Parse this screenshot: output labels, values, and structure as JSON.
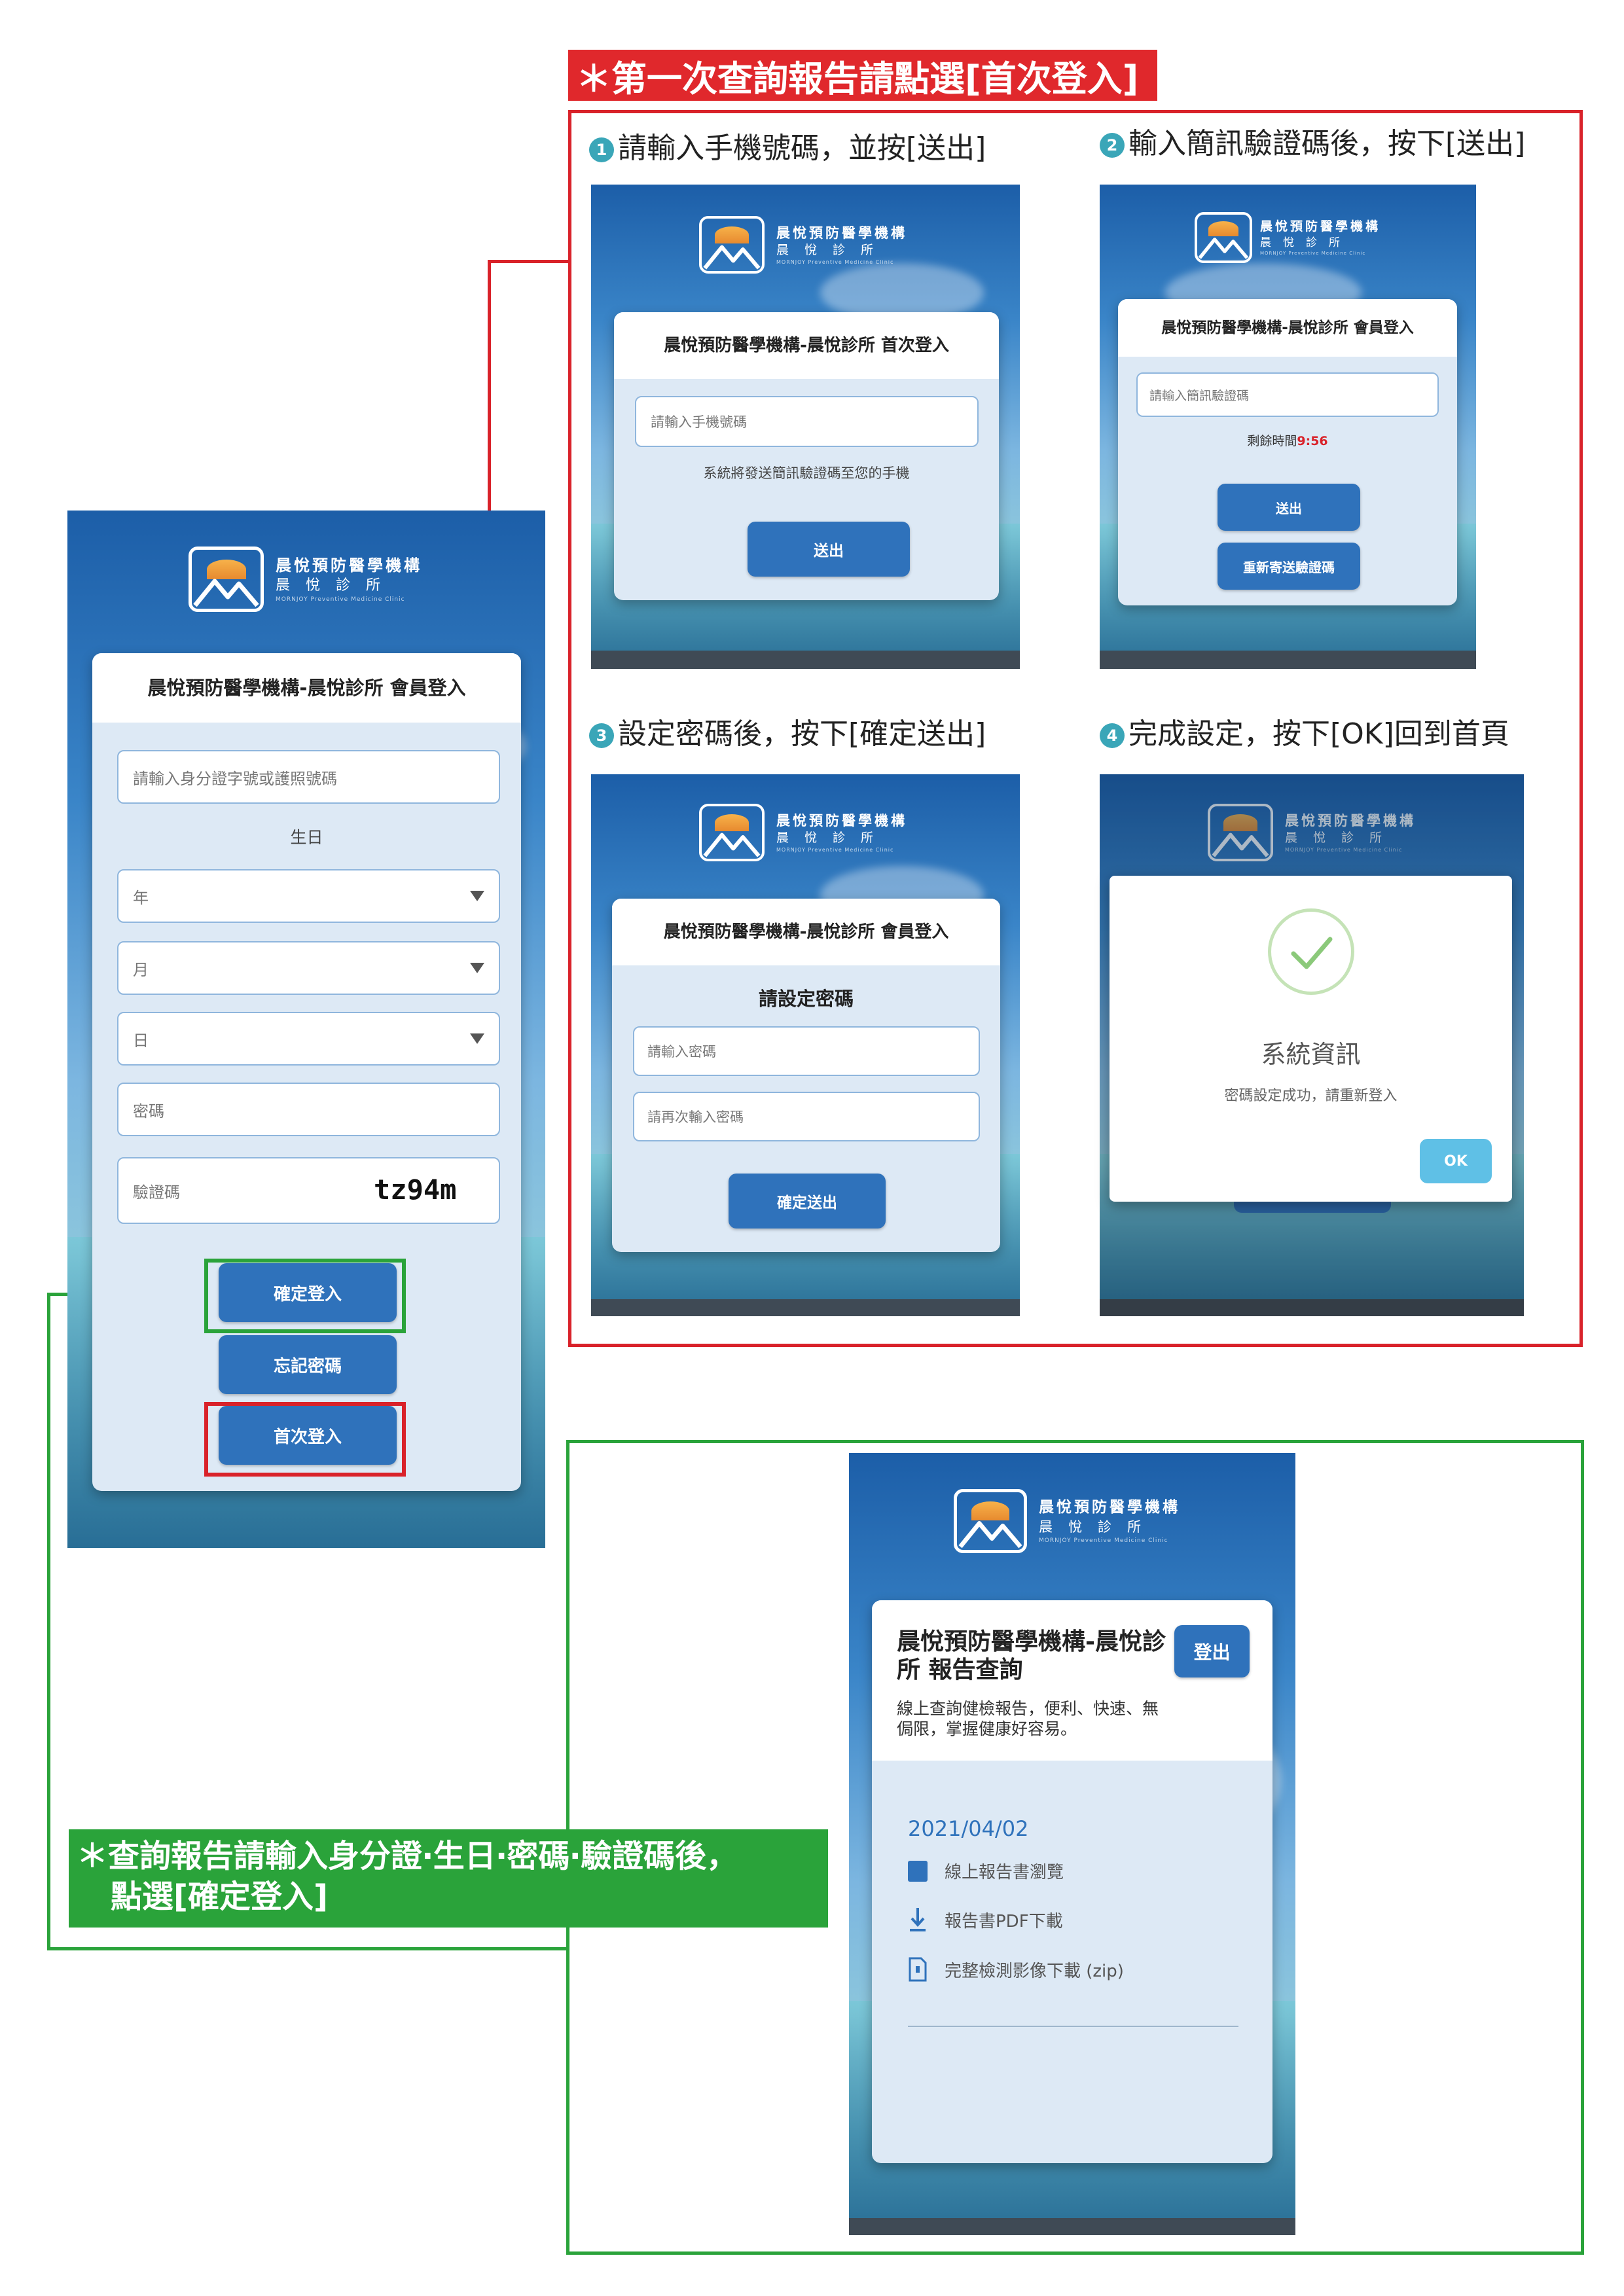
{
  "colors": {
    "red": "#d9222a",
    "green": "#2aa33a",
    "button": "#2f72bb",
    "card_bg": "#dde9f5",
    "ok": "#5fc0e6",
    "accent_text": "#d9222a"
  },
  "logo": {
    "line1": "晨悅預防醫學機構",
    "line2": "晨悅診所",
    "line3": "MORNJOY Preventive Medicine Clinic"
  },
  "first_time_banner": "＊第一次查詢報告請點選[首次登入]",
  "query_banner": {
    "line1": "＊查詢報告請輸入身分證‧生日‧密碼‧驗證碼後，",
    "line2": "點選[確定登入]"
  },
  "main_login": {
    "title": "晨悅預防醫學機構-晨悅診所 會員登入",
    "id_placeholder": "請輸入身分證字號或護照號碼",
    "birthday_label": "生日",
    "year": "年",
    "month": "月",
    "day": "日",
    "password_placeholder": "密碼",
    "captcha_placeholder": "驗證碼",
    "captcha_code": "tz94m",
    "login_button": "確定登入",
    "forgot_button": "忘記密碼",
    "first_login_button": "首次登入"
  },
  "steps": [
    {
      "num": "1",
      "label": "請輸入手機號碼，並按[送出]"
    },
    {
      "num": "2",
      "label": "輸入簡訊驗證碼後，按下[送出]"
    },
    {
      "num": "3",
      "label": "設定密碼後，按下[確定送出]"
    },
    {
      "num": "4",
      "label": "完成設定，按下[OK]回到首頁"
    }
  ],
  "step1": {
    "title": "晨悅預防醫學機構-晨悅診所 首次登入",
    "phone_placeholder": "請輸入手機號碼",
    "hint": "系統將發送簡訊驗證碼至您的手機",
    "submit": "送出"
  },
  "step2": {
    "title": "晨悅預防醫學機構-晨悅診所 會員登入",
    "code_placeholder": "請輸入簡訊驗證碼",
    "remaining_label": "剩餘時間",
    "remaining_time": "9:56",
    "submit": "送出",
    "resend": "重新寄送驗證碼"
  },
  "step3": {
    "title": "晨悅預防醫學機構-晨悅診所 會員登入",
    "heading": "請設定密碼",
    "password_placeholder": "請輸入密碼",
    "confirm_placeholder": "請再次輸入密碼",
    "submit": "確定送出"
  },
  "step4": {
    "title": "系統資訊",
    "message": "密碼設定成功，請重新登入",
    "ok": "OK"
  },
  "report": {
    "title": "晨悅預防醫學機構-晨悅診所 報告查詢",
    "subtitle": "線上查詢健檢報告，便利、快速、無侷限，掌握健康好容易。",
    "logout": "登出",
    "date": "2021/04/02",
    "items": [
      {
        "icon": "book-icon",
        "label": "線上報告書瀏覽"
      },
      {
        "icon": "download-icon",
        "label": "報告書PDF下載"
      },
      {
        "icon": "zip-file-icon",
        "label": "完整檢測影像下載 (zip)"
      }
    ]
  }
}
